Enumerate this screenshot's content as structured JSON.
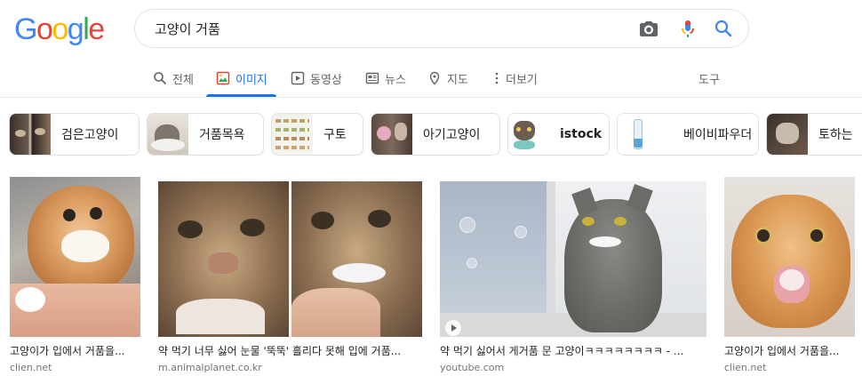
{
  "logo": {
    "letters": [
      "G",
      "o",
      "o",
      "g",
      "l",
      "e"
    ],
    "colors": [
      "#4285f4",
      "#ea4335",
      "#fbbc05",
      "#4285f4",
      "#34a853",
      "#ea4335"
    ]
  },
  "search": {
    "query": "고양이 거품"
  },
  "tabs": {
    "all": "전체",
    "images": "이미지",
    "videos": "동영상",
    "news": "뉴스",
    "maps": "지도",
    "more": "더보기",
    "tools": "도구"
  },
  "chips": [
    {
      "label": "검은고양이"
    },
    {
      "label": "거품목욕"
    },
    {
      "label": "구토"
    },
    {
      "label": "아기고양이"
    },
    {
      "label": "istock"
    },
    {
      "label": "베이비파우더"
    },
    {
      "label": "토하는"
    }
  ],
  "results": [
    {
      "caption": "고양이가 입에서 거품을...",
      "domain": "clien.net"
    },
    {
      "caption": "약 먹기 너무 싫어 눈물 '뚝뚝' 흘리다 못해 입에 거품...",
      "domain": "m.animalplanet.co.kr"
    },
    {
      "caption": "약 먹기 싫어서 게거품 문 고양이ㅋㅋㅋㅋㅋㅋㅋㅋ - ...",
      "domain": "youtube.com"
    },
    {
      "caption": "고양이가 입에서 거품을...",
      "domain": "clien.net"
    }
  ],
  "colors": {
    "accent": "#1a73e8",
    "border": "#dfe1e5",
    "muted": "#5f6368"
  }
}
